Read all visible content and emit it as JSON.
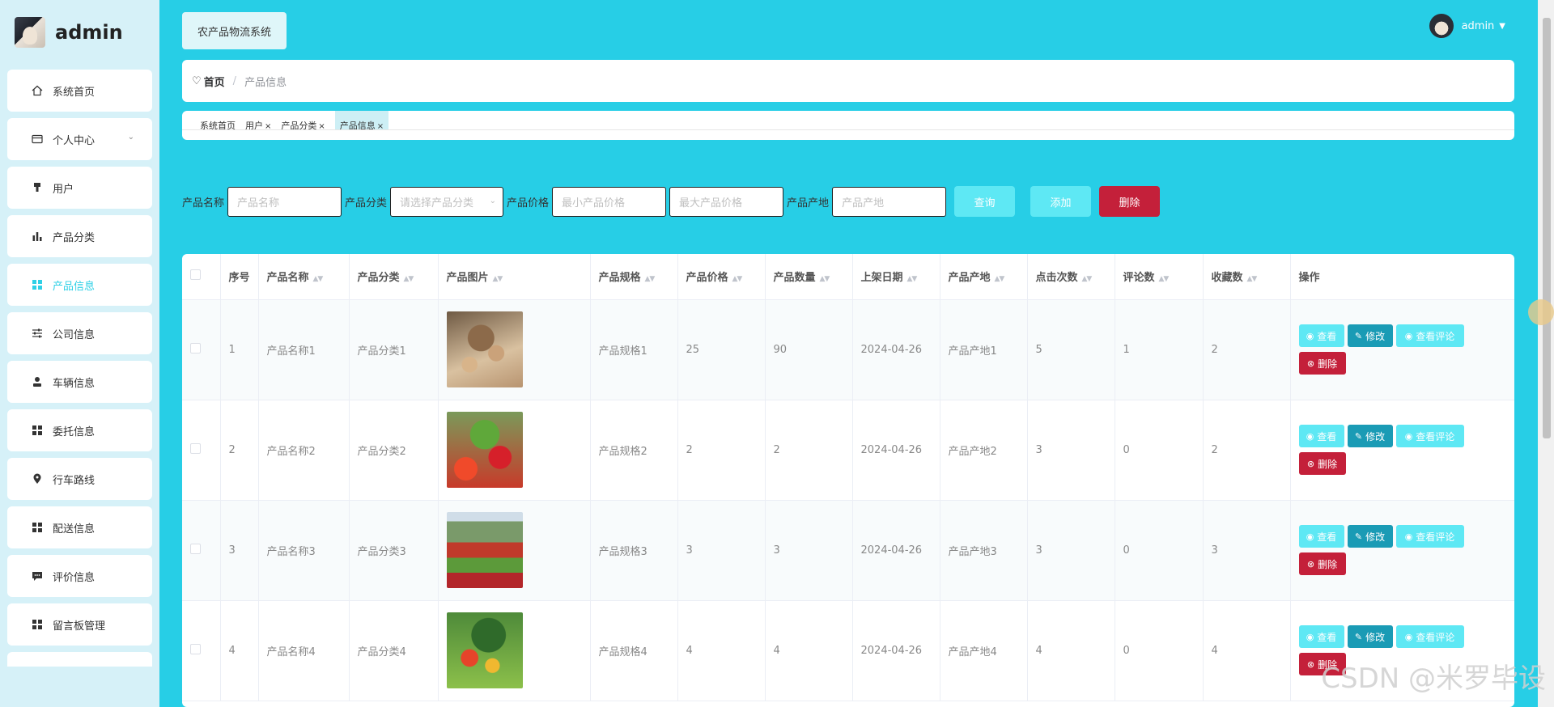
{
  "brand": {
    "name": "admin"
  },
  "sidebar": {
    "items": [
      {
        "label": "系统首页",
        "icon": "home-icon"
      },
      {
        "label": "个人中心",
        "icon": "card-icon",
        "has_submenu": true
      },
      {
        "label": "用户",
        "icon": "user-icon"
      },
      {
        "label": "产品分类",
        "icon": "bar-chart-icon"
      },
      {
        "label": "产品信息",
        "icon": "grid-icon",
        "active": true
      },
      {
        "label": "公司信息",
        "icon": "sliders-icon"
      },
      {
        "label": "车辆信息",
        "icon": "person-icon"
      },
      {
        "label": "委托信息",
        "icon": "grid-icon"
      },
      {
        "label": "行车路线",
        "icon": "pin-icon"
      },
      {
        "label": "配送信息",
        "icon": "grid-icon"
      },
      {
        "label": "评价信息",
        "icon": "comment-icon"
      },
      {
        "label": "留言板管理",
        "icon": "grid-icon"
      }
    ]
  },
  "header": {
    "system_title": "农产品物流系统",
    "user_name": "admin"
  },
  "breadcrumb": {
    "home": "首页",
    "separator": "/",
    "current": "产品信息"
  },
  "tags": [
    {
      "label": "系统首页",
      "closable": false
    },
    {
      "label": "用户",
      "closable": true
    },
    {
      "label": "产品分类",
      "closable": true
    },
    {
      "label": "产品信息",
      "closable": true,
      "active": true
    }
  ],
  "search": {
    "name_label": "产品名称",
    "name_placeholder": "产品名称",
    "category_label": "产品分类",
    "category_placeholder": "请选择产品分类",
    "price_label": "产品价格",
    "min_price_placeholder": "最小产品价格",
    "max_price_placeholder": "最大产品价格",
    "origin_label": "产品产地",
    "origin_placeholder": "产品产地",
    "query_button": "查询",
    "add_button": "添加",
    "delete_button": "删除"
  },
  "table": {
    "columns": [
      "序号",
      "产品名称",
      "产品分类",
      "产品图片",
      "产品规格",
      "产品价格",
      "产品数量",
      "上架日期",
      "产品产地",
      "点击次数",
      "评论数",
      "收藏数",
      "操作"
    ],
    "actions": {
      "view": "查看",
      "edit": "修改",
      "comments": "查看评论",
      "delete": "删除"
    },
    "rows": [
      {
        "index": "1",
        "name": "产品名称1",
        "category": "产品分类1",
        "image": "nuts",
        "spec": "产品规格1",
        "price": "25",
        "quantity": "90",
        "date": "2024-04-26",
        "origin": "产品产地1",
        "clicks": "5",
        "comments": "1",
        "favorites": "2"
      },
      {
        "index": "2",
        "name": "产品名称2",
        "category": "产品分类2",
        "image": "fruits",
        "spec": "产品规格2",
        "price": "2",
        "quantity": "2",
        "date": "2024-04-26",
        "origin": "产品产地2",
        "clicks": "3",
        "comments": "0",
        "favorites": "2"
      },
      {
        "index": "3",
        "name": "产品名称3",
        "category": "产品分类3",
        "image": "market",
        "spec": "产品规格3",
        "price": "3",
        "quantity": "3",
        "date": "2024-04-26",
        "origin": "产品产地3",
        "clicks": "3",
        "comments": "0",
        "favorites": "3"
      },
      {
        "index": "4",
        "name": "产品名称4",
        "category": "产品分类4",
        "image": "vegetables",
        "spec": "产品规格4",
        "price": "4",
        "quantity": "4",
        "date": "2024-04-26",
        "origin": "产品产地4",
        "clicks": "4",
        "comments": "0",
        "favorites": "4"
      }
    ]
  },
  "watermark": "CSDN @米罗毕设",
  "colors": {
    "primary": "#27cee6",
    "accent": "#5ee8f4",
    "edit": "#1a9bb5",
    "danger": "#c4203a",
    "sidebar_bg": "#d6f1f8"
  }
}
